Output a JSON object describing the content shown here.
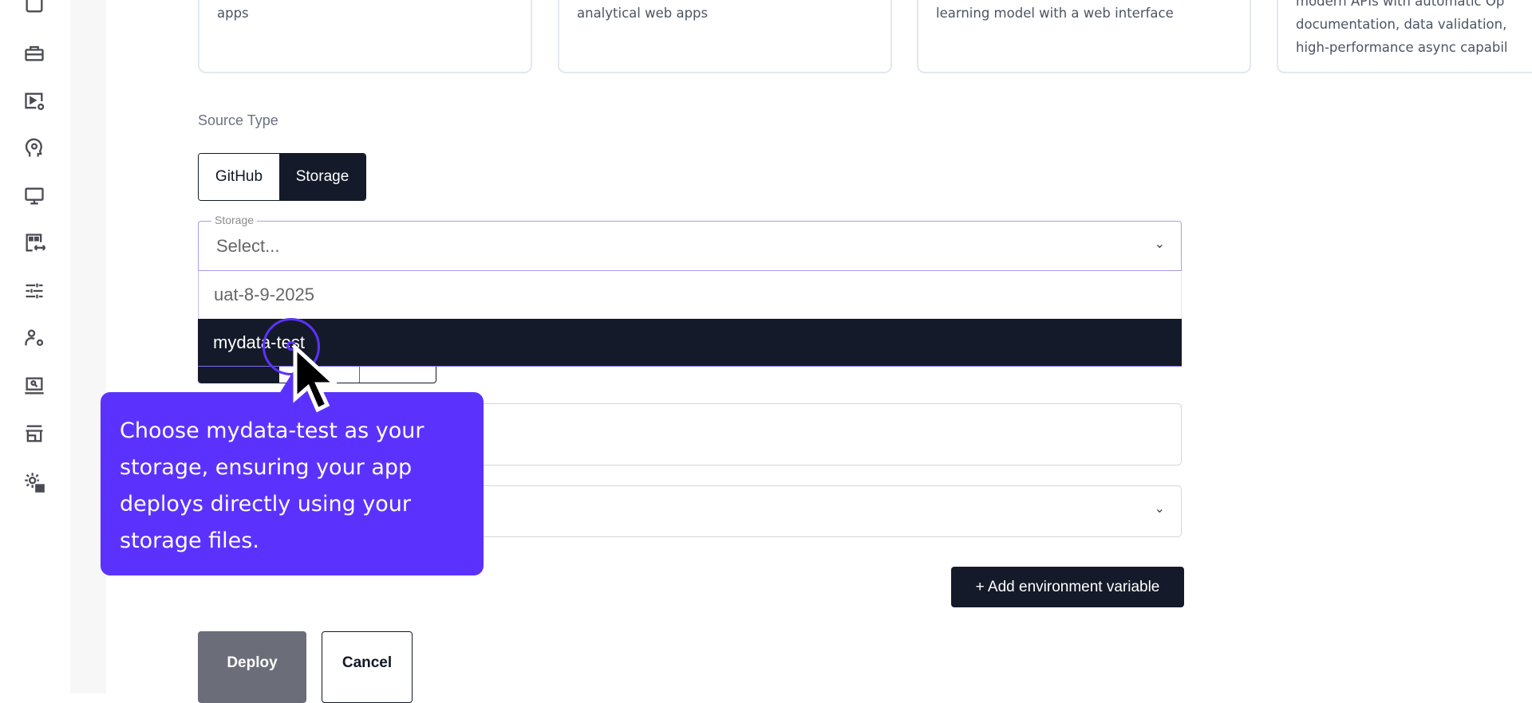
{
  "sidebar": {
    "icons": [
      "square-icon",
      "toolbox-icon",
      "video-settings-icon",
      "head-gear-icon",
      "monitor-icon",
      "apps-link-icon",
      "sliders-icon",
      "user-settings-icon",
      "laptop-search-icon",
      "store-icon",
      "gear-user-icon"
    ]
  },
  "cards": [
    {
      "lines": [
        "apps"
      ]
    },
    {
      "lines": [
        "analytical web apps"
      ]
    },
    {
      "lines": [
        "learning model with a web interface"
      ]
    },
    {
      "lines": [
        "modern APIs with automatic Op",
        "documentation, data validation,",
        "high-performance async capabil"
      ]
    }
  ],
  "form": {
    "source_type_label": "Source Type",
    "source_options": [
      "GitHub",
      "Storage"
    ],
    "selected_source": "Storage",
    "storage_label": "Storage",
    "storage_placeholder": "Select...",
    "storage_options": [
      "uat-8-9-2025",
      "mydata-test"
    ],
    "highlighted_option": "mydata-test",
    "add_env_label": "+ Add environment variable",
    "deploy_label": "Deploy",
    "cancel_label": "Cancel"
  },
  "tooltip": {
    "text": "Choose mydata-test as your storage, ensuring your app deploys directly using your storage files."
  },
  "colors": {
    "accent": "#5b32fd",
    "dark": "#141a29"
  }
}
